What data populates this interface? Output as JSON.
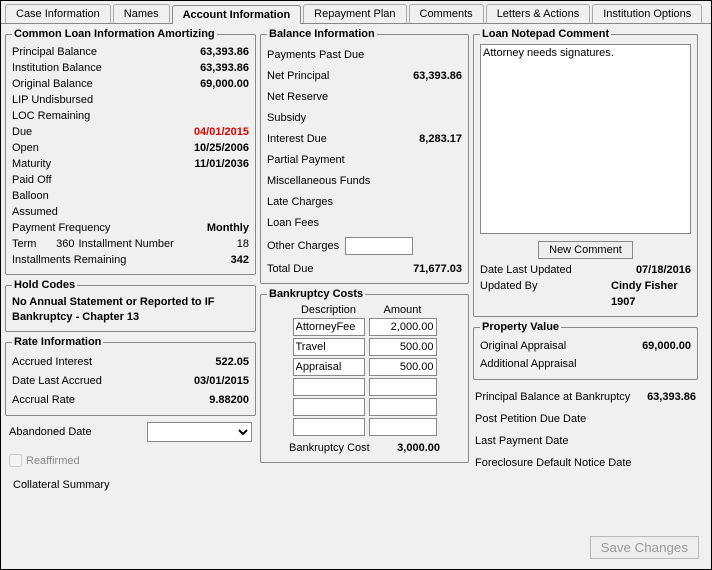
{
  "tabs": {
    "case_info": "Case Information",
    "names": "Names",
    "account_info": "Account Information",
    "repayment": "Repayment Plan",
    "comments": "Comments",
    "letters": "Letters & Actions",
    "institution": "Institution Options"
  },
  "common_loan": {
    "title": "Common Loan Information Amortizing",
    "principal_balance_label": "Principal Balance",
    "principal_balance": "63,393.86",
    "institution_balance_label": "Institution Balance",
    "institution_balance": "63,393.86",
    "original_balance_label": "Original Balance",
    "original_balance": "69,000.00",
    "lip_label": "LIP Undisbursed",
    "loc_label": "LOC Remaining",
    "due_label": "Due",
    "due": "04/01/2015",
    "open_label": "Open",
    "open": "10/25/2006",
    "maturity_label": "Maturity",
    "maturity": "11/01/2036",
    "paid_off_label": "Paid Off",
    "balloon_label": "Balloon",
    "assumed_label": "Assumed",
    "payment_freq_label": "Payment Frequency",
    "payment_freq": "Monthly",
    "term_label": "Term",
    "term": "360",
    "installment_num_label": "Installment Number",
    "installment_num": "18",
    "installments_remaining_label": "Installments Remaining",
    "installments_remaining": "342"
  },
  "hold_codes": {
    "title": "Hold Codes",
    "line1": "No Annual Statement or Reported to IF",
    "line2": "Bankruptcy - Chapter 13"
  },
  "rate_info": {
    "title": "Rate Information",
    "accrued_interest_label": "Accrued Interest",
    "accrued_interest": "522.05",
    "date_last_accrued_label": "Date Last Accrued",
    "date_last_accrued": "03/01/2015",
    "accrual_rate_label": "Accrual Rate",
    "accrual_rate": "9.88200"
  },
  "abandoned": {
    "label": "Abandoned Date",
    "reaffirmed_label": "Reaffirmed"
  },
  "collateral_summary_label": "Collateral Summary",
  "balance_info": {
    "title": "Balance Information",
    "payments_past_due_label": "Payments Past Due",
    "net_principal_label": "Net Principal",
    "net_principal": "63,393.86",
    "net_reserve_label": "Net Reserve",
    "subsidy_label": "Subsidy",
    "interest_due_label": "Interest Due",
    "interest_due": "8,283.17",
    "partial_payment_label": "Partial Payment",
    "misc_funds_label": "Miscellaneous Funds",
    "late_charges_label": "Late Charges",
    "loan_fees_label": "Loan Fees",
    "other_charges_label": "Other Charges",
    "total_due_label": "Total Due",
    "total_due": "71,677.03"
  },
  "bankruptcy_costs": {
    "title": "Bankruptcy Costs",
    "desc_header": "Description",
    "amount_header": "Amount",
    "rows": [
      {
        "desc": "AttorneyFee",
        "amount": "2,000.00"
      },
      {
        "desc": "Travel",
        "amount": "500.00"
      },
      {
        "desc": "Appraisal",
        "amount": "500.00"
      },
      {
        "desc": "",
        "amount": ""
      },
      {
        "desc": "",
        "amount": ""
      },
      {
        "desc": "",
        "amount": ""
      }
    ],
    "total_label": "Bankruptcy Cost",
    "total": "3,000.00"
  },
  "notepad": {
    "title": "Loan Notepad Comment",
    "text": "Attorney needs signatures.",
    "new_comment_btn": "New Comment",
    "date_updated_label": "Date Last Updated",
    "date_updated": "07/18/2016",
    "updated_by_label": "Updated By",
    "updated_by": "Cindy Fisher",
    "updated_by2": "1907"
  },
  "property_value": {
    "title": "Property Value",
    "original_label": "Original Appraisal",
    "original": "69,000.00",
    "additional_label": "Additional Appraisal"
  },
  "bottom": {
    "principal_at_bk_label": "Principal Balance at Bankruptcy",
    "principal_at_bk": "63,393.86",
    "post_petition_label": "Post Petition Due Date",
    "last_payment_label": "Last Payment Date",
    "foreclosure_label": "Foreclosure Default Notice Date"
  },
  "save_btn": "Save Changes"
}
